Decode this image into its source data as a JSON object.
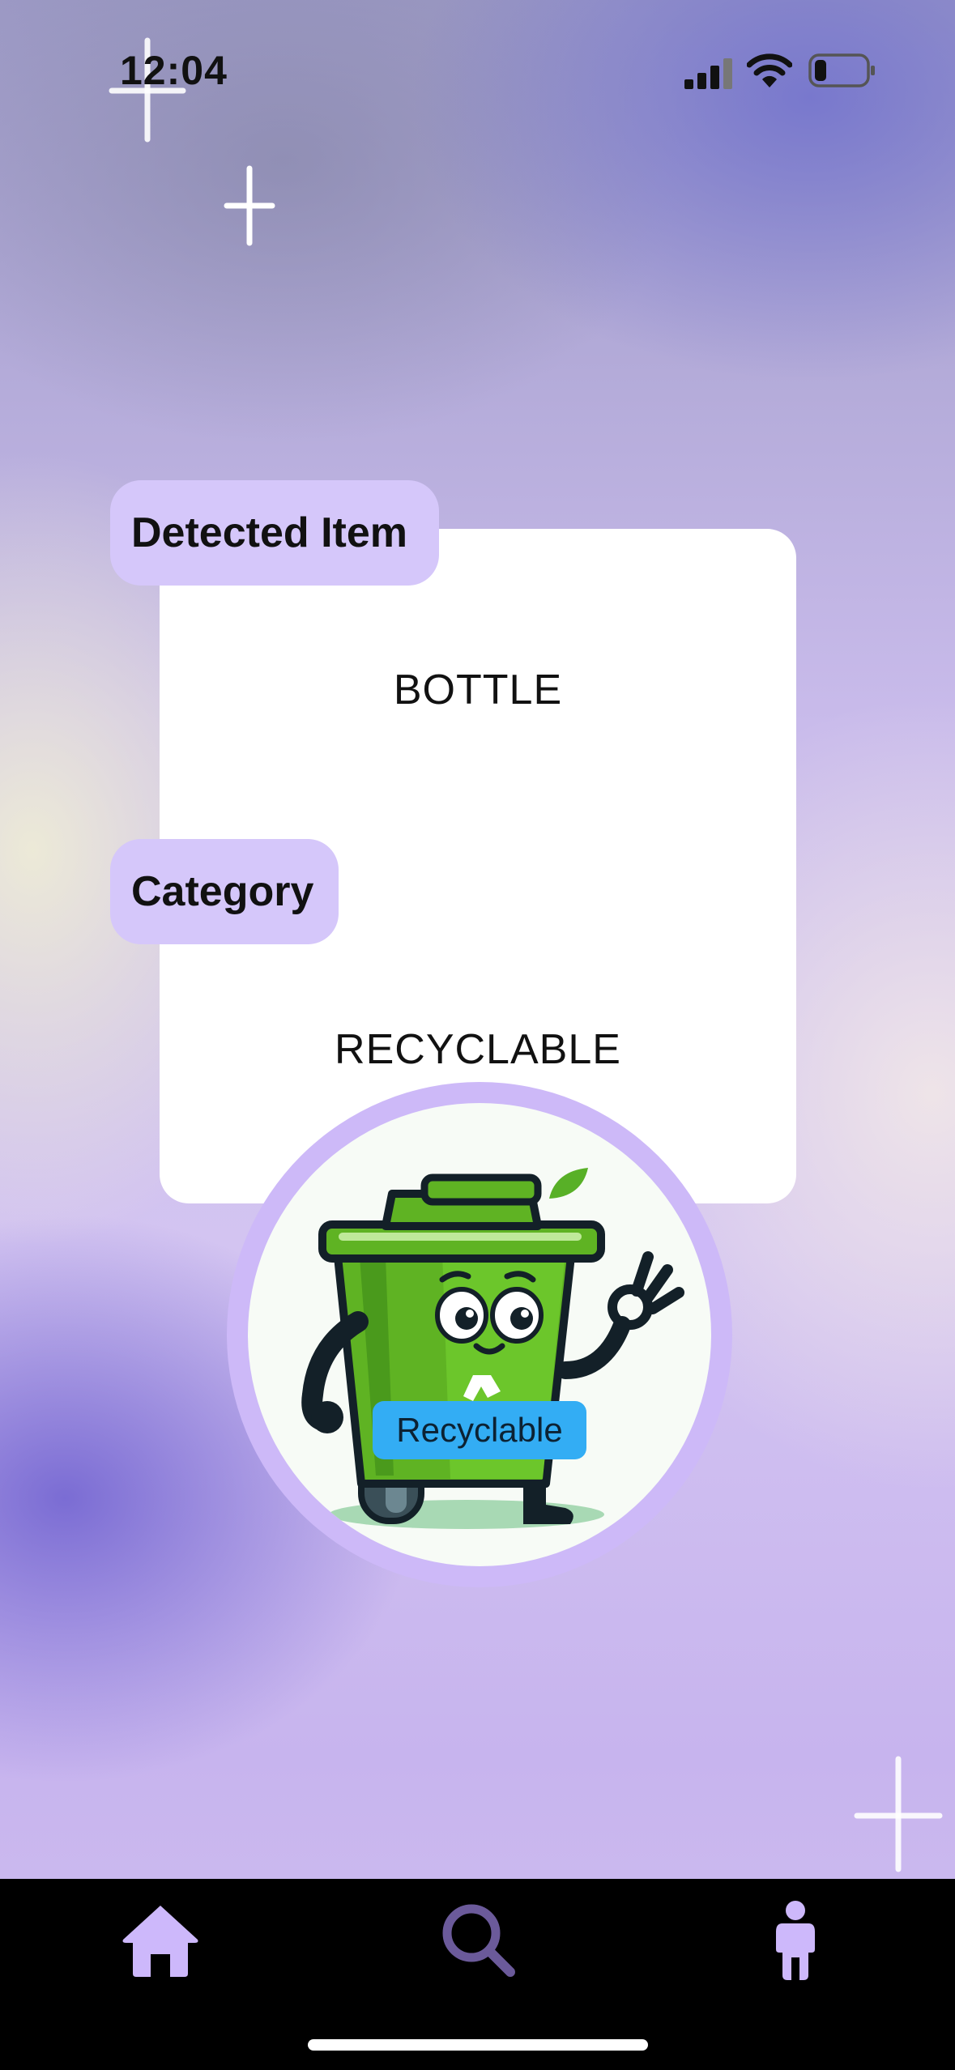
{
  "status_bar": {
    "time": "12:04",
    "signal_icon": "signal-icon",
    "wifi_icon": "wifi-icon",
    "battery_icon": "battery-low-icon"
  },
  "result": {
    "detected_label": "Detected Item",
    "detected_value": "BOTTLE",
    "category_label": "Category",
    "category_value": "RECYCLABLE"
  },
  "mascot": {
    "badge": "Recyclable",
    "image": "recycling-bin-mascot"
  },
  "bottom_nav": {
    "items": [
      {
        "icon": "home-icon"
      },
      {
        "icon": "search-icon"
      },
      {
        "icon": "person-icon"
      }
    ]
  },
  "colors": {
    "accent": "#d5c7fa",
    "nav_icon": "#cdb8fb",
    "search_icon": "#6b5a9a",
    "badge": "#33adf4"
  }
}
